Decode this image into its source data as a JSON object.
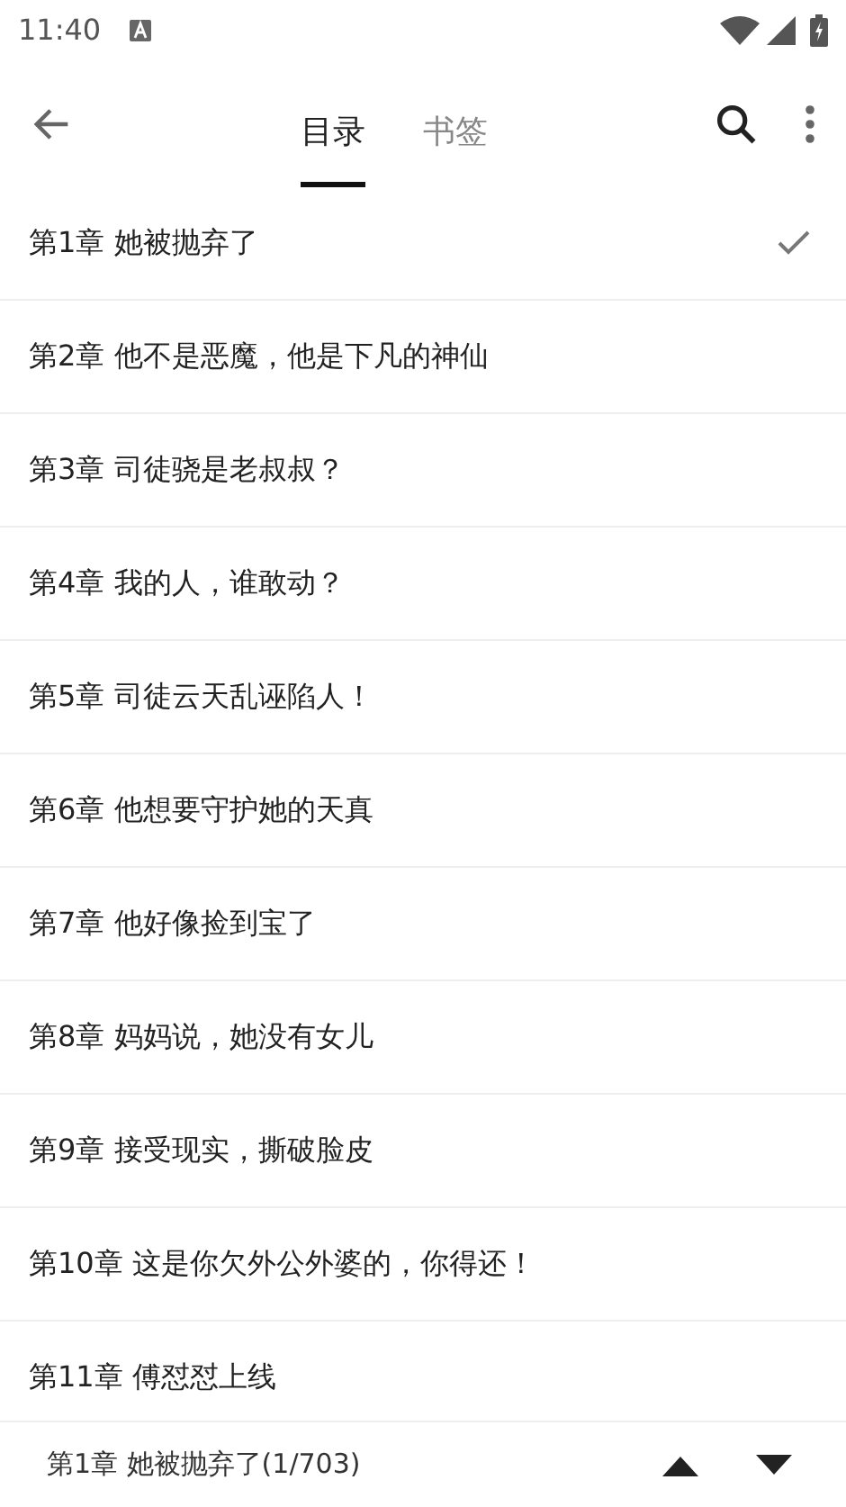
{
  "status_bar": {
    "time": "11:40"
  },
  "tabs": [
    {
      "label": "目录",
      "selected": true
    },
    {
      "label": "书签",
      "selected": false
    }
  ],
  "chapters": [
    {
      "title": "第1章 她被抛弃了",
      "selected": true
    },
    {
      "title": "第2章 他不是恶魔，他是下凡的神仙",
      "selected": false
    },
    {
      "title": "第3章 司徒骁是老叔叔？",
      "selected": false
    },
    {
      "title": "第4章 我的人，谁敢动？",
      "selected": false
    },
    {
      "title": "第5章 司徒云天乱诬陷人！",
      "selected": false
    },
    {
      "title": "第6章 他想要守护她的天真",
      "selected": false
    },
    {
      "title": "第7章 他好像捡到宝了",
      "selected": false
    },
    {
      "title": "第8章 妈妈说，她没有女儿",
      "selected": false
    },
    {
      "title": "第9章 接受现实，撕破脸皮",
      "selected": false
    },
    {
      "title": "第10章 这是你欠外公外婆的，你得还！",
      "selected": false
    },
    {
      "title": "第11章 傅怼怼上线",
      "selected": false
    }
  ],
  "footer": {
    "current": "第1章 她被抛弃了(1/703)"
  }
}
